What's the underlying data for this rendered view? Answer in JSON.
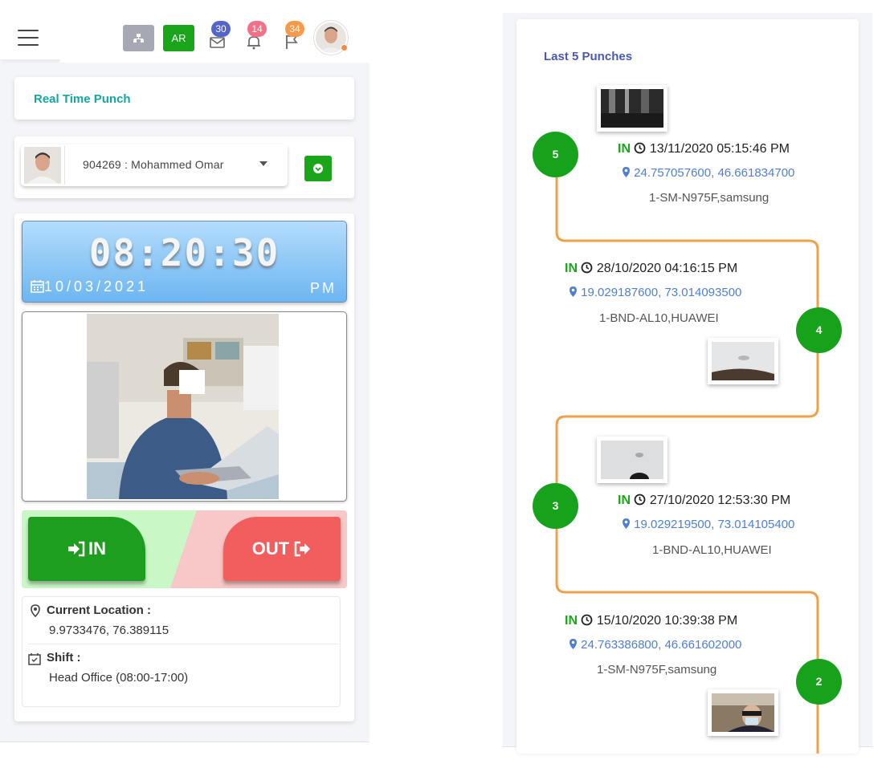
{
  "header": {
    "ar_label": "AR",
    "mail_count": "30",
    "bell_count": "14",
    "flag_count": "34",
    "colors": {
      "green": "#1aa51a",
      "mail_badge": "#5465c9",
      "bell_badge": "#f37088",
      "flag_badge": "#f79b4a"
    }
  },
  "realtime": {
    "title": "Real Time Punch",
    "employee": "904269 : Mohammed Omar",
    "time": "08:20:30",
    "date": "10/03/2021",
    "ampm": "PM",
    "in_label": "IN",
    "out_label": "OUT",
    "current_location_label": "Current Location :",
    "current_location": "9.9733476, 76.389115",
    "shift_label": "Shift :",
    "shift": "Head Office (08:00-17:00)"
  },
  "timeline": {
    "title": "Last 5 Punches",
    "entries": [
      {
        "node": "5",
        "type": "IN",
        "datetime": "13/11/2020 05:15:46 PM",
        "location": "24.757057600, 46.661834700",
        "device": "1-SM-N975F,samsung"
      },
      {
        "node": "4",
        "type": "IN",
        "datetime": "28/10/2020 04:16:15 PM",
        "location": "19.029187600, 73.014093500",
        "device": "1-BND-AL10,HUAWEI"
      },
      {
        "node": "3",
        "type": "IN",
        "datetime": "27/10/2020 12:53:30 PM",
        "location": "19.029219500, 73.014105400",
        "device": "1-BND-AL10,HUAWEI"
      },
      {
        "node": "2",
        "type": "IN",
        "datetime": "15/10/2020 10:39:38 PM",
        "location": "24.763386800, 46.661602000",
        "device": "1-SM-N975F,samsung"
      }
    ],
    "line_color": "#f0a04b"
  }
}
